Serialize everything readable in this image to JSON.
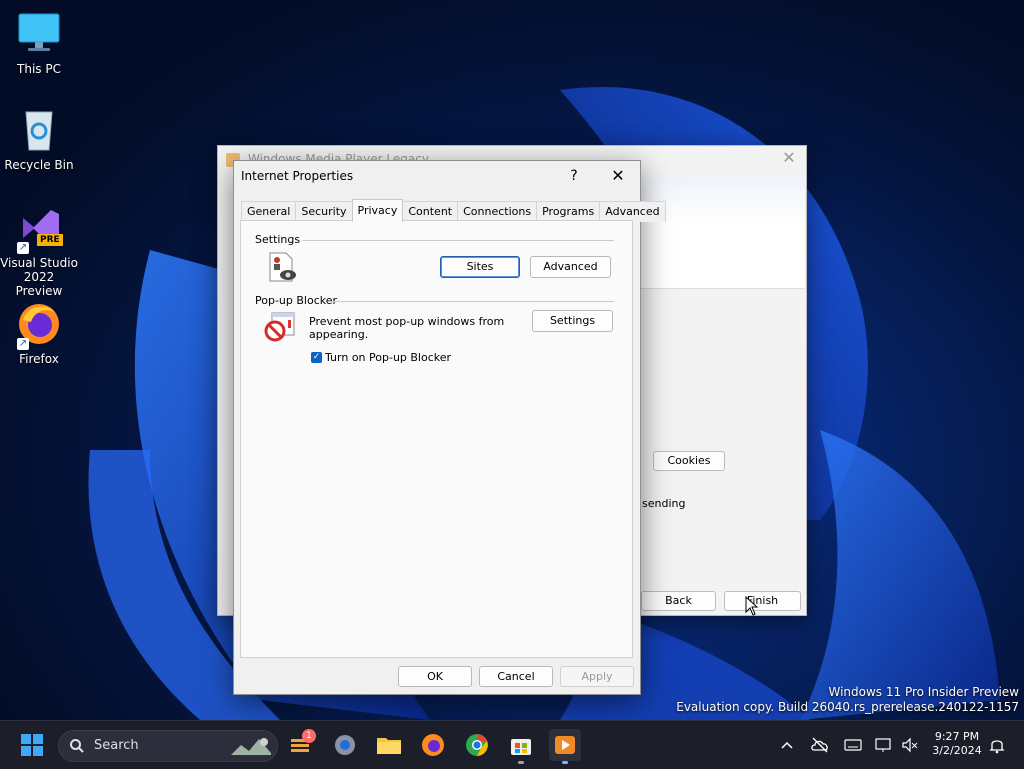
{
  "desktop": {
    "icons": [
      {
        "label": "This PC"
      },
      {
        "label": "Recycle Bin"
      },
      {
        "label": "Visual Studio 2022 Preview",
        "badge": "PRE"
      },
      {
        "label": "Firefox"
      }
    ]
  },
  "wizard": {
    "title": "Windows Media Player Legacy",
    "cookies_label": "Cookies",
    "partial_text": "sending",
    "back_label": "Back",
    "finish_label": "Finish"
  },
  "dialog": {
    "title": "Internet Properties",
    "help_glyph": "?",
    "close_glyph": "✕",
    "tabs": [
      {
        "label": "General"
      },
      {
        "label": "Security"
      },
      {
        "label": "Privacy",
        "active": true
      },
      {
        "label": "Content"
      },
      {
        "label": "Connections"
      },
      {
        "label": "Programs"
      },
      {
        "label": "Advanced"
      }
    ],
    "settings_group": "Settings",
    "sites_label": "Sites",
    "advanced_label": "Advanced",
    "popup_group": "Pop-up Blocker",
    "popup_text": "Prevent most pop-up windows from appearing.",
    "popup_settings_label": "Settings",
    "checkbox_label": "Turn on Pop-up Blocker",
    "checkbox_checked": true,
    "ok_label": "OK",
    "cancel_label": "Cancel",
    "apply_label": "Apply"
  },
  "watermark": {
    "line1": "Windows 11 Pro Insider Preview",
    "line2": "Evaluation copy. Build 26040.rs_prerelease.240122-1157"
  },
  "taskbar": {
    "search_placeholder": "Search",
    "widgets_badge": "1",
    "time": "9:27 PM",
    "date": "3/2/2024"
  },
  "colors": {
    "accent": "#0b63c5",
    "taskbar": "#1c1f2a"
  }
}
